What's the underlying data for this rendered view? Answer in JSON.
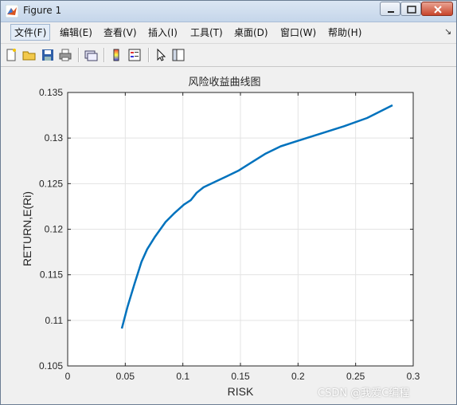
{
  "window": {
    "title": "Figure 1"
  },
  "menu": [
    "文件(F)",
    "编辑(E)",
    "查看(V)",
    "插入(I)",
    "工具(T)",
    "桌面(D)",
    "窗口(W)",
    "帮助(H)"
  ],
  "menu_overflow": "↘",
  "toolbar": [
    "new-figure-icon",
    "open-icon",
    "save-icon",
    "print-icon",
    "link-icon",
    "colorbar-icon",
    "legend-icon",
    "arrow-icon",
    "panel-icon"
  ],
  "watermark": "CSDN @我爱C编程",
  "chart_data": {
    "type": "line",
    "title": "风险收益曲线图",
    "xlabel": "RISK",
    "ylabel": "RETURN,E(Ri)",
    "xlim": [
      0,
      0.3
    ],
    "ylim": [
      0.105,
      0.135
    ],
    "xticks": [
      0,
      0.05,
      0.1,
      0.15,
      0.2,
      0.25,
      0.3
    ],
    "xtick_labels": [
      "0",
      "0.05",
      "0.1",
      "0.15",
      "0.2",
      "0.25",
      "0.3"
    ],
    "yticks": [
      0.105,
      0.11,
      0.115,
      0.12,
      0.125,
      0.13,
      0.135
    ],
    "ytick_labels": [
      "0.105",
      "0.11",
      "0.115",
      "0.12",
      "0.125",
      "0.13",
      "0.135"
    ],
    "grid": true,
    "line_color": "#0072bd",
    "series": [
      {
        "x": [
          0.047,
          0.052,
          0.058,
          0.064,
          0.069,
          0.076,
          0.085,
          0.093,
          0.101,
          0.107,
          0.112,
          0.118,
          0.128,
          0.138,
          0.148,
          0.158,
          0.172,
          0.185,
          0.2,
          0.22,
          0.24,
          0.26,
          0.282
        ],
        "y": [
          0.1091,
          0.1115,
          0.114,
          0.1164,
          0.1178,
          0.1192,
          0.1208,
          0.1218,
          0.1227,
          0.1232,
          0.124,
          0.1246,
          0.1252,
          0.1258,
          0.1264,
          0.1272,
          0.1283,
          0.1291,
          0.1297,
          0.1305,
          0.1313,
          0.1322,
          0.1336
        ]
      }
    ]
  }
}
